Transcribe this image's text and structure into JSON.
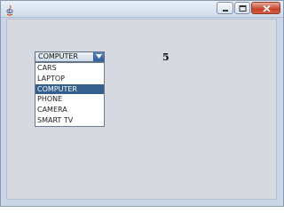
{
  "window": {
    "icon": "java-icon",
    "controls": [
      "minimize-icon",
      "maximize-icon",
      "close-icon"
    ]
  },
  "combo": {
    "selected": "COMPUTER",
    "arrow_icon": "chevron-down-icon",
    "options": [
      "CARS",
      "LAPTOP",
      "COMPUTER",
      "PHONE",
      "CAMERA",
      "SMART TV"
    ],
    "selected_index": 2
  },
  "count": "5",
  "colors": {
    "selection": "#35608e",
    "panel": "#d6d9e0"
  }
}
